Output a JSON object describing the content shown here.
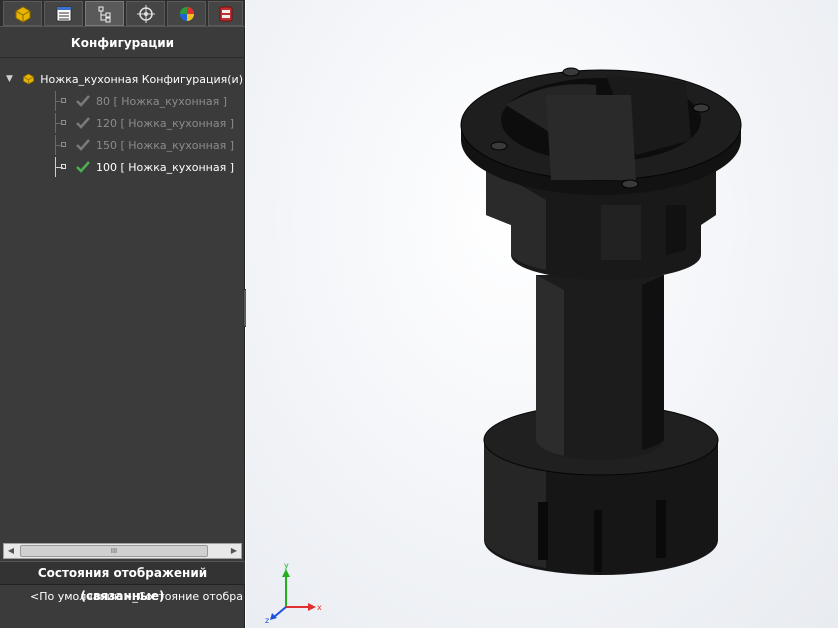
{
  "panel": {
    "title": "Конфигурации",
    "tabs": [
      {
        "icon": "feature-manager-icon",
        "active": false
      },
      {
        "icon": "property-manager-icon",
        "active": false
      },
      {
        "icon": "configuration-manager-icon",
        "active": true
      },
      {
        "icon": "dimxpert-manager-icon",
        "active": false
      },
      {
        "icon": "display-manager-icon",
        "active": false
      },
      {
        "icon": "cam-manager-icon",
        "active": false
      }
    ],
    "tree": {
      "root_label": "Ножка_кухонная Конфигурация(и)",
      "configurations": [
        {
          "label": "80 [ Ножка_кухонная ]",
          "active": false
        },
        {
          "label": "120 [ Ножка_кухонная ]",
          "active": false
        },
        {
          "label": "150 [ Ножка_кухонная ]",
          "active": false
        },
        {
          "label": "100 [ Ножка_кухонная ]",
          "active": true
        }
      ]
    },
    "scroll_thumb": "III",
    "display_states": {
      "header": "Состояния отображений (связанные)",
      "item": "<По умолчанию>_Состояние отображения"
    }
  },
  "triad": {
    "x": "x",
    "y": "y",
    "z": "z"
  },
  "colors": {
    "panel_bg": "#3b3b3b",
    "model": "#1f1f1f",
    "check_active": "#4caf50",
    "check_inactive": "#7a7a7a",
    "axis_x": "#e03030",
    "axis_y": "#20b020",
    "axis_z": "#2050e0"
  }
}
